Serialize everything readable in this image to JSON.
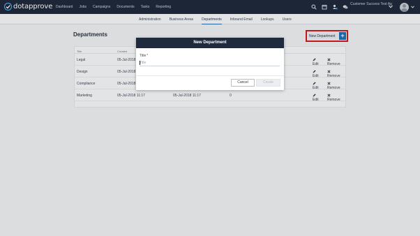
{
  "app": {
    "logo_text": "dotapprove"
  },
  "nav": {
    "items": [
      "Dashboard",
      "Jobs",
      "Campaigns",
      "Documents",
      "Tasks",
      "Reporting"
    ]
  },
  "user": {
    "name": "Customer Success Test Ag"
  },
  "subnav": {
    "items": [
      "Administration",
      "Business Areas",
      "Departments",
      "Inbound Email",
      "Lookups",
      "Users"
    ],
    "active": "Departments"
  },
  "page": {
    "title": "Departments",
    "new_button_label": "New Department",
    "new_button_icon": "+"
  },
  "table": {
    "headers": {
      "title": "Title",
      "created": "Created"
    },
    "rows": [
      {
        "title": "Legal",
        "created": "05-Jul-2018",
        "modified": "",
        "count": ""
      },
      {
        "title": "Design",
        "created": "05-Jul-2018",
        "modified": "",
        "count": ""
      },
      {
        "title": "Compliance",
        "created": "05-Jul-2018",
        "modified": "",
        "count": ""
      },
      {
        "title": "Marketing",
        "created": "05-Jul-2018 11:17",
        "modified": "05-Jul-2018 11:17",
        "count": "0"
      }
    ],
    "edit_label": "Edit",
    "remove_label": "Remove"
  },
  "modal": {
    "title": "New Department",
    "field_label": "Title",
    "required_mark": "*",
    "field_placeholder": "Title",
    "field_value": "",
    "cancel_label": "Cancel",
    "create_label": "Create"
  },
  "colors": {
    "topbar": "#1f2a3c",
    "accent": "#1f6fb5",
    "highlight": "#d21a1a"
  }
}
